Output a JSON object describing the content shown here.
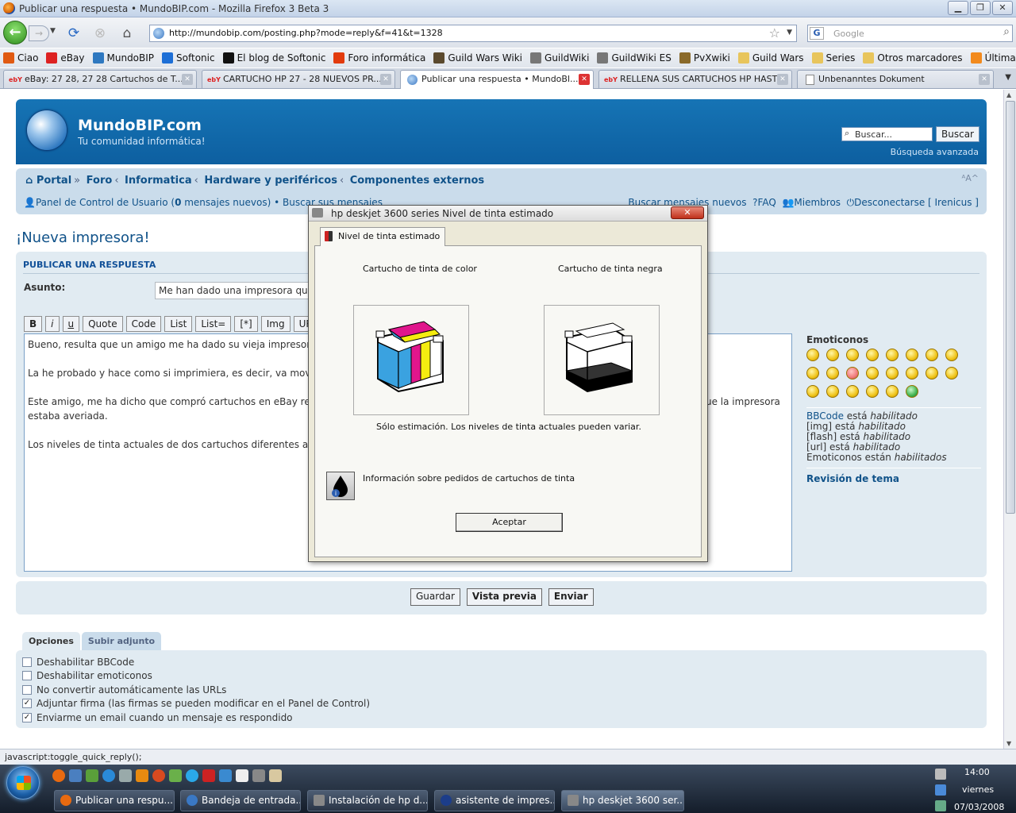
{
  "window": {
    "title": "Publicar una respuesta • MundoBIP.com - Mozilla Firefox 3 Beta 3",
    "minimize": "▁",
    "maximize": "❐",
    "close": "✕"
  },
  "navbar": {
    "url": "http://mundobip.com/posting.php?mode=reply&f=41&t=1328",
    "search_placeholder": "Google"
  },
  "bookmarks": [
    {
      "label": "Ciao",
      "icon": "ciao-icon",
      "color": "#e05a12"
    },
    {
      "label": "eBay",
      "icon": "ebay-icon",
      "color": "#d22"
    },
    {
      "label": "MundoBIP",
      "icon": "globe-icon",
      "color": "#2e78c0"
    },
    {
      "label": "Softonic",
      "icon": "softonic-icon",
      "color": "#1d6fd6"
    },
    {
      "label": "El blog de Softonic",
      "icon": "blog-icon",
      "color": "#111"
    },
    {
      "label": "Foro informática",
      "icon": "forum-icon",
      "color": "#e23b0d"
    },
    {
      "label": "Guild Wars Wiki",
      "icon": "guildwars-icon",
      "color": "#5b4a2e"
    },
    {
      "label": "GuildWiki",
      "icon": "guildwiki-icon",
      "color": "#777"
    },
    {
      "label": "GuildWiki ES",
      "icon": "guildwiki-icon",
      "color": "#777"
    },
    {
      "label": "PvXwiki",
      "icon": "pvx-icon",
      "color": "#8a6a2a"
    },
    {
      "label": "Guild Wars",
      "icon": "folder-icon",
      "color": "#e8c55c"
    },
    {
      "label": "Series",
      "icon": "folder-icon",
      "color": "#e8c55c"
    },
    {
      "label": "Otros marcadores",
      "icon": "folder-icon",
      "color": "#e8c55c"
    },
    {
      "label": "Últimas noticias",
      "icon": "rss-icon",
      "color": "#f28a1d"
    }
  ],
  "tabs": [
    {
      "label": "eBay: 27 28, 27 28 Cartuchos de T...",
      "prefix": "ebY"
    },
    {
      "label": "CARTUCHO HP 27 - 28 NUEVOS PR...",
      "prefix": "ebY"
    },
    {
      "label": "Publicar una respuesta • MundoBl...",
      "prefix": ""
    },
    {
      "label": "RELLENA SUS CARTUCHOS HP HAST...",
      "prefix": "ebY"
    },
    {
      "label": "Unbenanntes Dokument",
      "prefix": ""
    }
  ],
  "site": {
    "name": "MundoBIP.com",
    "tagline": "Tu comunidad informática!",
    "search_placeholder": "Buscar...",
    "search_button": "Buscar",
    "advanced_search": "Búsqueda avanzada"
  },
  "breadcrumb": [
    "Portal",
    "Foro",
    "Informatica",
    "Hardware y periféricos",
    "Componentes externos"
  ],
  "userbar": {
    "ucp": "Panel de Control de Usuario (",
    "ucp_count": "0",
    "ucp_tail": " mensajes nuevos) • Buscar sus mensajes",
    "new_posts": "Buscar mensajes nuevos",
    "faq": "FAQ",
    "members": "Miembros",
    "logout": "Desconectarse [ Irenicus ]"
  },
  "page_title": "¡Nueva impresora!",
  "post": {
    "section_title": "PUBLICAR UNA RESPUESTA",
    "subject_label": "Asunto:",
    "subject_value": "Me han dado una impresora que",
    "bbcode_buttons": [
      "B",
      "i",
      "u",
      "Quote",
      "Code",
      "List",
      "List=",
      "[*]",
      "Img",
      "URL"
    ],
    "body": [
      "Bueno, resulta que un amigo me ha dado su vieja impresora",
      "La he probado y hace como si imprimiera, es decir, va movi",
      "Este amigo, me ha dicho que compró cartuchos en eBay relle",
      "estaba averiada.",
      "Los niveles de tinta actuales de dos cartuchos diferentes a l"
    ],
    "body_right_fragment": "ue la impresora"
  },
  "smilies": {
    "label": "Emoticonos",
    "items": [
      "😁",
      "😃",
      "😦",
      "😮",
      "😵",
      "😕",
      "😎",
      "😄",
      "😢",
      "😛",
      "😡",
      "😟",
      "😈",
      "😈",
      "😆",
      "🙂",
      "!",
      "?",
      "💡",
      "➡",
      "😐",
      "😬"
    ]
  },
  "bbinfo": {
    "bbcode": "BBCode",
    "bbcode_tail": " está ",
    "img": "[img] está ",
    "flash": "[flash] está ",
    "url": "[url] está ",
    "emoticons": "Emoticonos están ",
    "enabled": "habilitado",
    "enabled_pl": "habilitados",
    "topic_review": "Revisión de tema"
  },
  "submit": {
    "save": "Guardar",
    "preview": "Vista previa",
    "send": "Enviar"
  },
  "options": {
    "tabs": [
      "Opciones",
      "Subir adjunto"
    ],
    "items": [
      {
        "label": "Deshabilitar BBCode",
        "checked": false
      },
      {
        "label": "Deshabilitar emoticonos",
        "checked": false
      },
      {
        "label": "No convertir automáticamente las URLs",
        "checked": false
      },
      {
        "label": "Adjuntar firma (las firmas se pueden modificar en el Panel de Control)",
        "checked": true
      },
      {
        "label": "Enviarme un email cuando un mensaje es respondido",
        "checked": true
      }
    ]
  },
  "statusbar": "javascript:toggle_quick_reply();",
  "dialog": {
    "title": "hp deskjet 3600 series Nivel de tinta estimado",
    "close": "✕",
    "tab": "Nivel de tinta estimado",
    "color_label": "Cartucho de tinta de color",
    "black_label": "Cartucho de tinta negra",
    "estimate_note": "Sólo estimación. Los niveles de tinta actuales pueden variar.",
    "info_label": "Información sobre pedidos de cartuchos de tinta",
    "ok": "Aceptar"
  },
  "taskbar": {
    "tasks": [
      {
        "label": "Publicar una respu...",
        "color": "#e86a10"
      },
      {
        "label": "Bandeja de entrada...",
        "color": "#3a78c4"
      },
      {
        "label": "Instalación de hp d...",
        "color": "#888"
      },
      {
        "label": "asistente de impres...",
        "color": "#1c3d8a"
      },
      {
        "label": "hp deskjet 3600 ser...",
        "color": "#888"
      }
    ],
    "time": "14:00",
    "day": "viernes",
    "date": "07/03/2008"
  }
}
